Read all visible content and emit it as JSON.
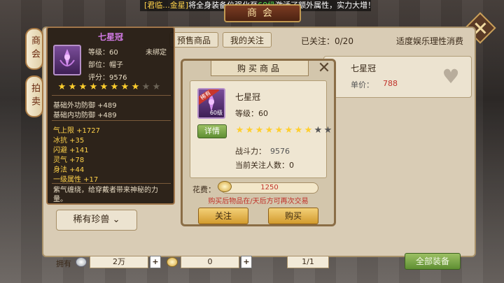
{
  "announcement": {
    "prefix": "[君临",
    "ellipsis": "...",
    "name_tail": "金星]",
    "mid": "将全身装备位强化至",
    "level": "60级",
    "tail": "激活了额外属性，实力大增！"
  },
  "window": {
    "title": "商会"
  },
  "side_tabs": [
    "商会",
    "拍卖"
  ],
  "top_tabs": [
    "预售商品",
    "我的关注"
  ],
  "follow_count": "已关注：0/20",
  "slogan": "适度娱乐理性消费",
  "listing": {
    "name": "七星冠",
    "price_label": "单价：",
    "price": "788"
  },
  "rare_button": "稀有珍兽 ⌄",
  "bottom": {
    "owned_label": "拥有",
    "silver": "2万",
    "gold": "0",
    "page": "1/1",
    "all_equip": "全部装备"
  },
  "tooltip": {
    "title": "七星冠",
    "level": "等级：60",
    "binding": "未绑定",
    "slot": "部位：帽子",
    "score": "评分：9576",
    "stars_on": 8,
    "stars_total": 10,
    "base_attrs": [
      "基础外功防御 +489",
      "基础内功防御 +489"
    ],
    "extra_attrs": [
      "气上限 +1727",
      "冰抗 +35",
      "闪避 +141",
      "灵气 +78",
      "身法 +44",
      "一级属性 +17"
    ],
    "description": "紫气缠绕，给穿戴者带来神秘的力量。"
  },
  "dialog": {
    "title": "购买商品",
    "rarity": "稀有",
    "icon_level": "60级",
    "detail_btn": "详情",
    "item_name": "七星冠",
    "level": "等级：60",
    "stars_on": 8,
    "stars_total": 10,
    "power_label": "战斗力：",
    "power_value": "9576",
    "watchers": "当前关注人数：0",
    "cost_label": "花费：",
    "cost": "1250",
    "note": "购买后物品在/天后方可再次交易",
    "follow_btn": "关注",
    "buy_btn": "购买"
  },
  "colors": {
    "gold": "#ffcf2e",
    "purple_title": "#d37be6",
    "price_red": "#c0322a"
  }
}
